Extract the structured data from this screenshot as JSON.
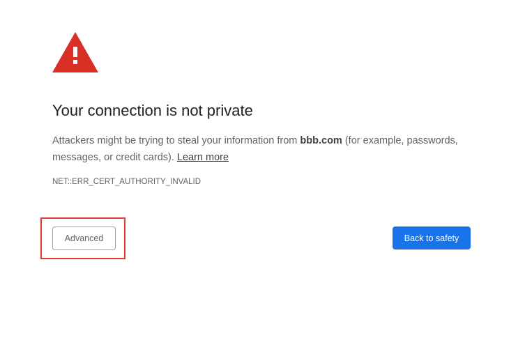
{
  "interstitial": {
    "title": "Your connection is not private",
    "description_before": "Attackers might be trying to steal your information from ",
    "domain": "bbb.com",
    "description_after": " (for example, passwords, messages, or credit cards). ",
    "learn_more_label": "Learn more",
    "error_code": "NET::ERR_CERT_AUTHORITY_INVALID",
    "advanced_label": "Advanced",
    "back_to_safety_label": "Back to safety",
    "icon": "warning-triangle-icon"
  },
  "colors": {
    "warning_icon": "#d93025",
    "primary_button": "#1a73e8",
    "highlight_box": "#e53935",
    "title_text": "#202124",
    "body_text": "#5f6368"
  }
}
